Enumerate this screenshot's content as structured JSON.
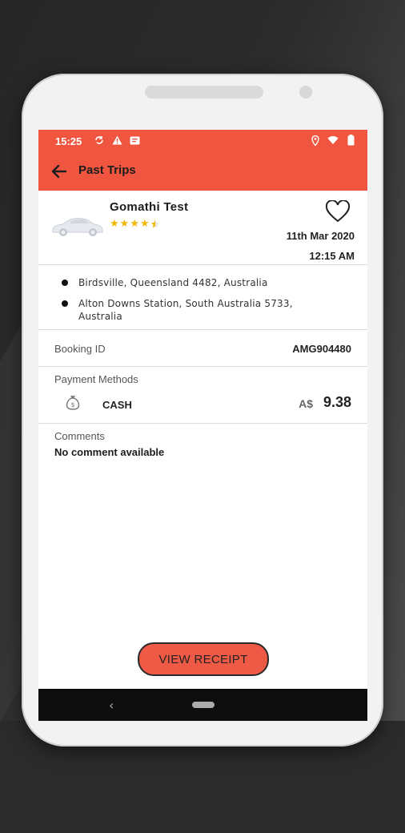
{
  "status_bar": {
    "time": "15:25"
  },
  "app_bar": {
    "title": "Past Trips"
  },
  "trip": {
    "driver_name": "Gomathi Test",
    "rating": 4.5,
    "date": "11th Mar 2020",
    "time": "12:15 AM",
    "pickup": "Birdsville, Queensland 4482, Australia",
    "dropoff": "Alton Downs Station, South Australia 5733, Australia"
  },
  "booking": {
    "label": "Booking ID",
    "id": "AMG904480"
  },
  "payment": {
    "label": "Payment Methods",
    "method": "CASH",
    "currency": "A$",
    "amount": "9.38"
  },
  "comments": {
    "label": "Comments",
    "text": "No comment available"
  },
  "actions": {
    "view_receipt": "VIEW RECEIPT"
  },
  "colors": {
    "accent": "#f0563f",
    "star": "#f2b705"
  }
}
